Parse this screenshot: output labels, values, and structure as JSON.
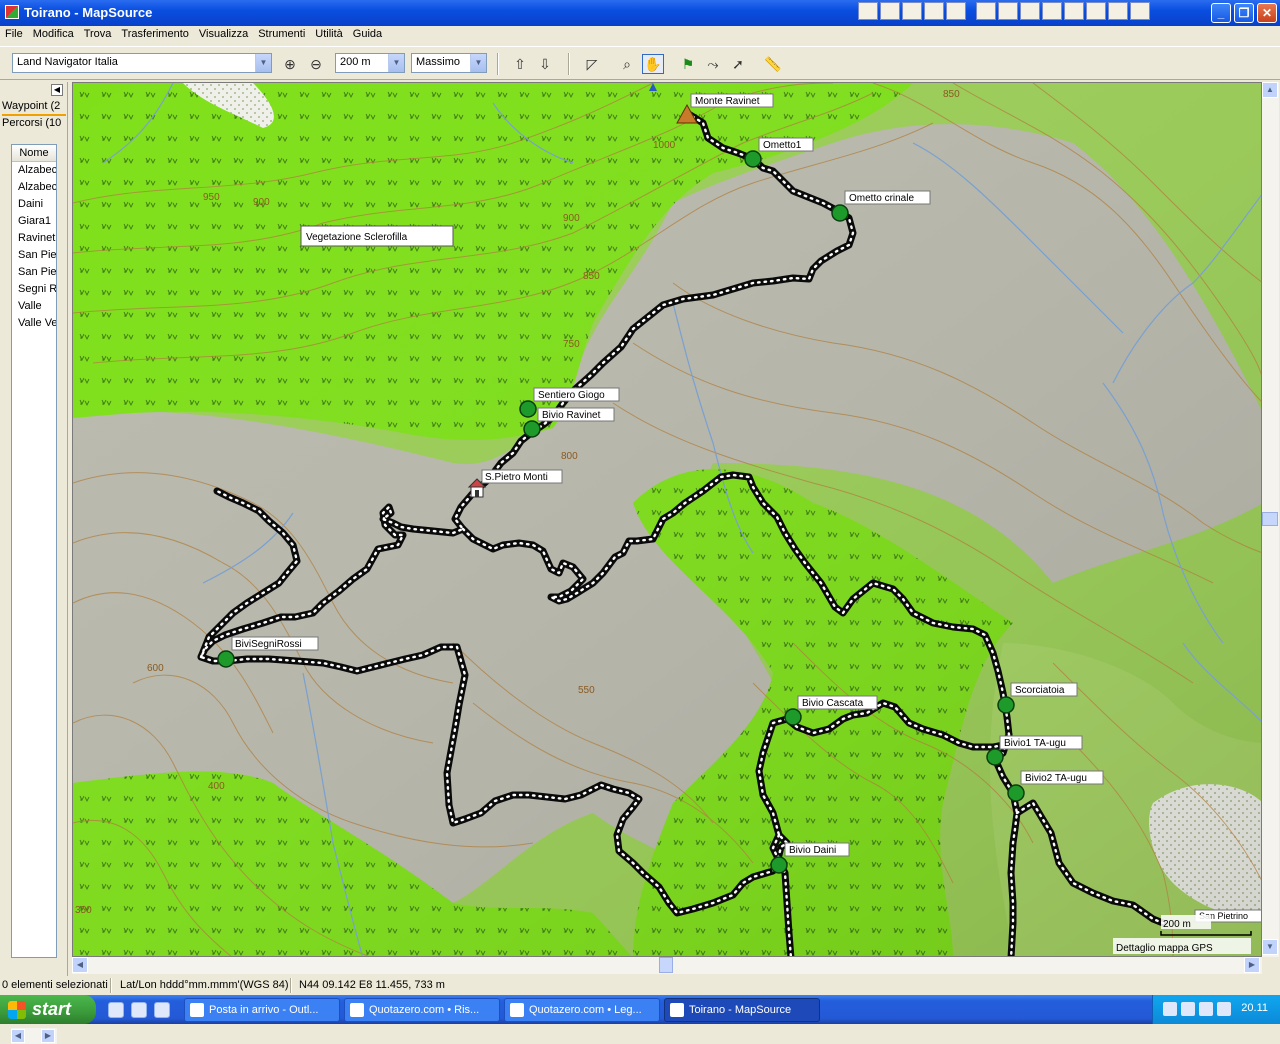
{
  "window": {
    "title": "Toirano - MapSource"
  },
  "menu": [
    "File",
    "Modifica",
    "Trova",
    "Trasferimento",
    "Visualizza",
    "Strumenti",
    "Utilità",
    "Guida"
  ],
  "toolbar": {
    "map_product": "Land Navigator Italia",
    "scale": "200 m",
    "detail": "Massimo"
  },
  "sidepanel": {
    "tabs": [
      "Waypoint (2",
      "Percorsi (10"
    ],
    "column_header": "Nome",
    "items": [
      "Alzabec",
      "Alzabec",
      "Daini",
      "Giara1",
      "Ravinet",
      "San Pie",
      "San Pie",
      "Segni R",
      "Valle",
      "Valle Ve"
    ]
  },
  "map": {
    "area_label": "Vegetazione Sclerofilla",
    "waypoints": [
      {
        "name": "Monte Ravinet",
        "symbol": "summit"
      },
      {
        "name": "Ometto1",
        "symbol": "green-pin"
      },
      {
        "name": "Ometto crinale",
        "symbol": "green-pin"
      },
      {
        "name": "Sentiero Giogo",
        "symbol": "green-pin"
      },
      {
        "name": "Bivio Ravinet",
        "symbol": "green-pin"
      },
      {
        "name": "S.Pietro Monti",
        "symbol": "church"
      },
      {
        "name": "BiviSegniRossi",
        "symbol": "green-pin"
      },
      {
        "name": "Bivio Cascata",
        "symbol": "green-pin"
      },
      {
        "name": "Scorciatoia",
        "symbol": "green-pin"
      },
      {
        "name": "Bivio1 TA-ugu",
        "symbol": "green-pin"
      },
      {
        "name": "Bivio2 TA-ugu",
        "symbol": "green-pin"
      },
      {
        "name": "Bivio Daini",
        "symbol": "green-pin"
      },
      {
        "name": "San Pietrino",
        "symbol": "label"
      }
    ],
    "contour_labels": [
      "850",
      "1000",
      "900",
      "950",
      "900",
      "850",
      "750",
      "800",
      "550",
      "400",
      "600",
      "350"
    ],
    "scale_bar": "200 m",
    "detail_note": "Dettaglio mappa GPS"
  },
  "statusbar": {
    "selection": "0 elementi selezionati",
    "format": "Lat/Lon hddd°mm.mmm'(WGS 84)",
    "position": "N44 09.142 E8 11.455, 733 m"
  },
  "taskbar": {
    "start": "start",
    "tasks": [
      "Posta in arrivo - Outl...",
      "Quotazero.com • Ris...",
      "Quotazero.com • Leg...",
      "Toirano - MapSource"
    ],
    "clock": "20.11"
  },
  "colors": {
    "vegetation_green": "#7fe01a",
    "bare_grey": "#b4b4a8",
    "light_green": "#a8d86a",
    "contour": "#b08040",
    "track": "#101010",
    "stream": "#7aa0d0"
  }
}
